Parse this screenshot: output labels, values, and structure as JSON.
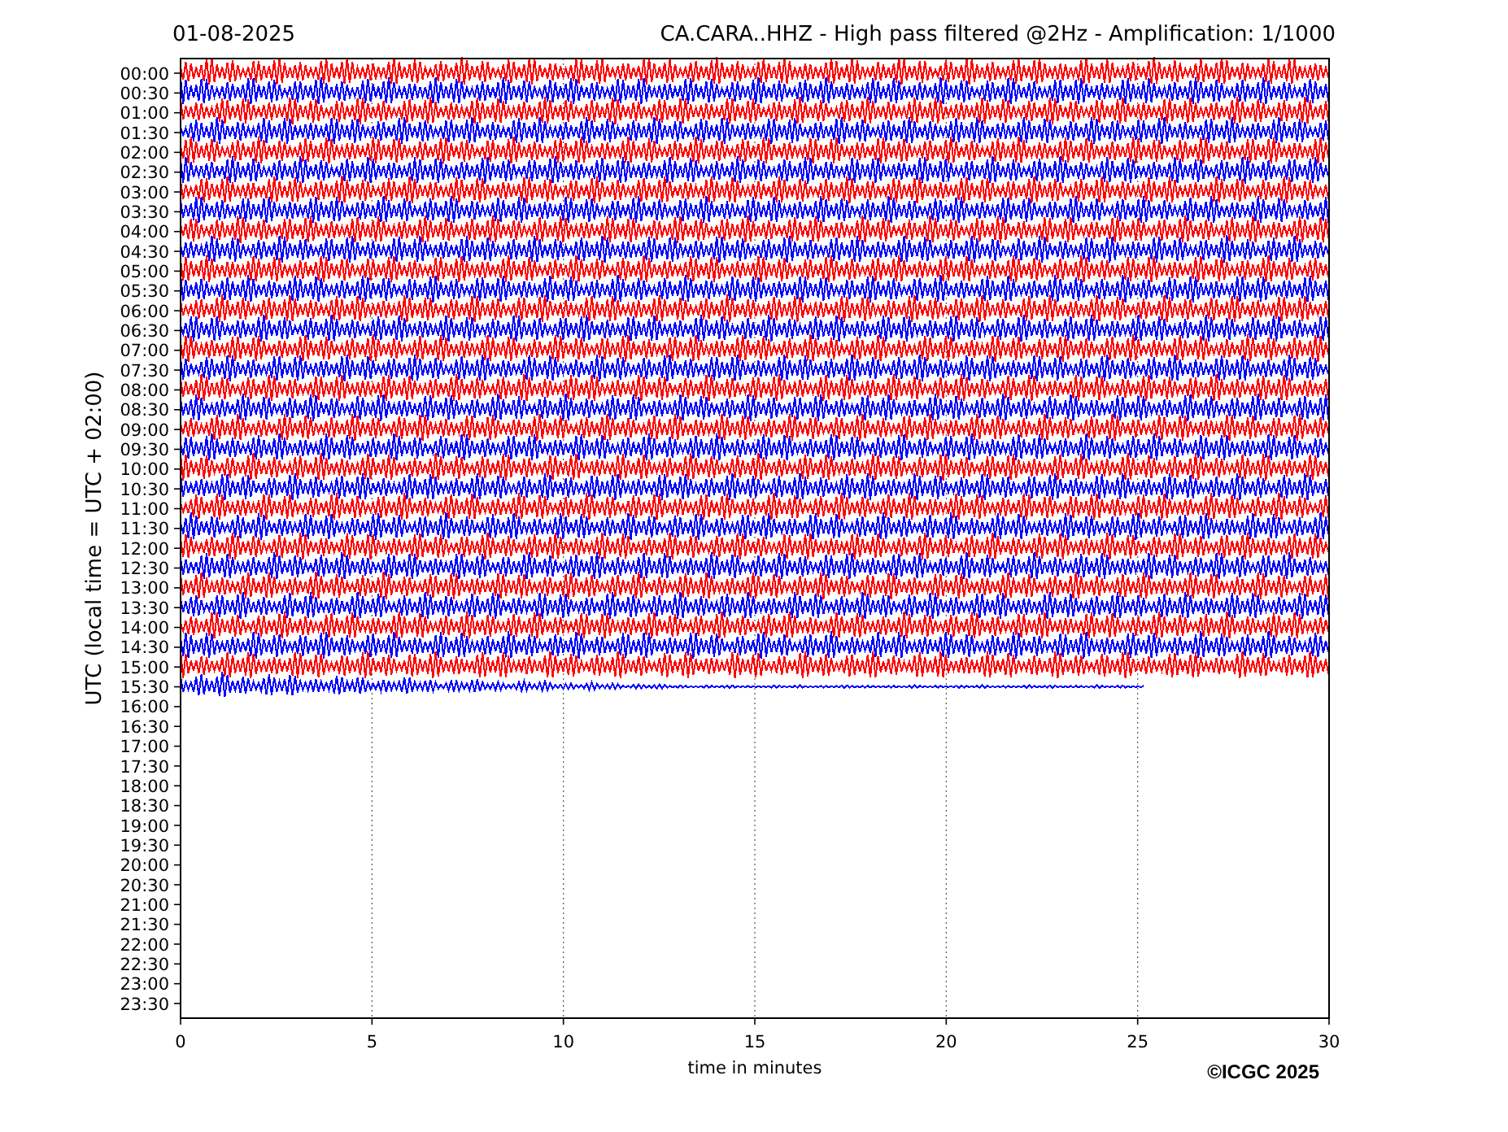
{
  "date": "01-08-2025",
  "title": "CA.CARA..HHZ - High pass filtered @2Hz - Amplification: 1/1000",
  "ylabel": "UTC (local time =  UTC + 02:00)",
  "xlabel": "time in minutes",
  "copyright": "©ICGC 2025",
  "xticks": [
    "0",
    "5",
    "10",
    "15",
    "20",
    "25",
    "30"
  ],
  "yticks": [
    "00:00",
    "00:30",
    "01:00",
    "01:30",
    "02:00",
    "02:30",
    "03:00",
    "03:30",
    "04:00",
    "04:30",
    "05:00",
    "05:30",
    "06:00",
    "06:30",
    "07:00",
    "07:30",
    "08:00",
    "08:30",
    "09:00",
    "09:30",
    "10:00",
    "10:30",
    "11:00",
    "11:30",
    "12:00",
    "12:30",
    "13:00",
    "13:30",
    "14:00",
    "14:30",
    "15:00",
    "15:30",
    "16:00",
    "16:30",
    "17:00",
    "17:30",
    "18:00",
    "18:30",
    "19:00",
    "19:30",
    "20:00",
    "20:30",
    "21:00",
    "21:30",
    "22:00",
    "22:30",
    "23:00",
    "23:30"
  ],
  "traces": [
    {
      "color": "#ff0000",
      "level": 1
    },
    {
      "color": "#0000ff",
      "level": 1
    },
    {
      "color": "#ff0000",
      "level": 1
    },
    {
      "color": "#0000ff",
      "level": 1
    },
    {
      "color": "#ff0000",
      "level": 1
    },
    {
      "color": "#0000ff",
      "level": 1
    },
    {
      "color": "#ff0000",
      "level": 1
    },
    {
      "color": "#0000ff",
      "level": 1
    },
    {
      "color": "#ff0000",
      "level": 1
    },
    {
      "color": "#0000ff",
      "level": 1
    },
    {
      "color": "#ff0000",
      "level": 1
    },
    {
      "color": "#0000ff",
      "level": 1
    },
    {
      "color": "#ff0000",
      "level": 1
    },
    {
      "color": "#0000ff",
      "level": 1
    },
    {
      "color": "#ff0000",
      "level": 1
    },
    {
      "color": "#0000ff",
      "level": 1
    },
    {
      "color": "#ff0000",
      "level": 1
    },
    {
      "color": "#0000ff",
      "level": 1
    },
    {
      "color": "#ff0000",
      "level": 1
    },
    {
      "color": "#0000ff",
      "level": 1
    },
    {
      "color": "#ff0000",
      "level": 1
    },
    {
      "color": "#0000ff",
      "level": 1
    },
    {
      "color": "#ff0000",
      "level": 1
    },
    {
      "color": "#0000ff",
      "level": 1
    },
    {
      "color": "#ff0000",
      "level": 1
    },
    {
      "color": "#0000ff",
      "level": 1
    },
    {
      "color": "#ff0000",
      "level": 1
    },
    {
      "color": "#0000ff",
      "level": 1
    },
    {
      "color": "#ff0000",
      "level": 1
    },
    {
      "color": "#0000ff",
      "level": 1
    },
    {
      "color": "#ff0000",
      "level": 1
    },
    {
      "color": "#0000ff",
      "level": 0.84
    }
  ]
}
